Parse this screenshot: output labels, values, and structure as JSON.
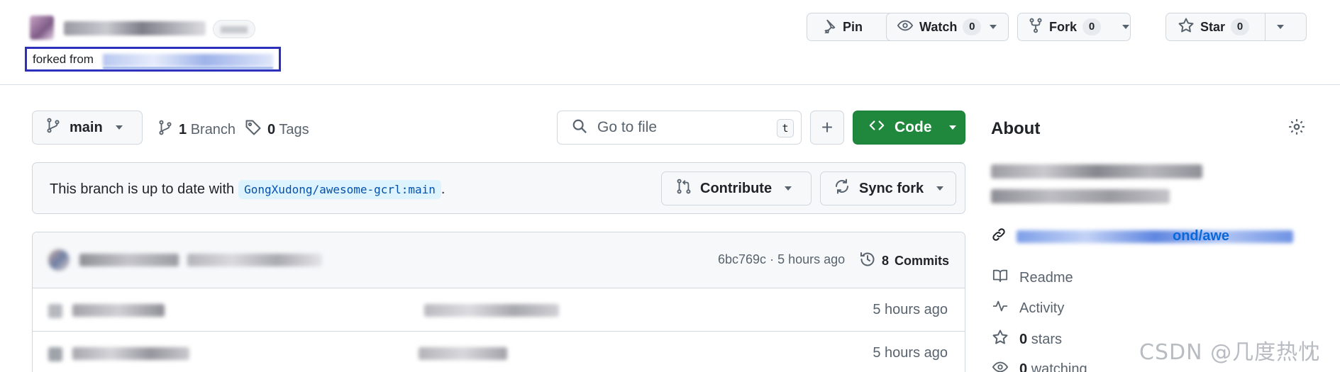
{
  "header": {
    "forked_from_label": "forked from",
    "pin_label": "Pin",
    "watch_label": "Watch",
    "watch_count": "0",
    "fork_label": "Fork",
    "fork_count": "0",
    "star_label": "Star",
    "star_count": "0"
  },
  "branch_bar": {
    "current_branch": "main",
    "branch_count": "1",
    "branch_label": "Branch",
    "tag_count": "0",
    "tag_label": "Tags",
    "search_placeholder": "Go to file",
    "search_shortcut": "t",
    "add_label": "+",
    "code_label": "Code"
  },
  "sync": {
    "status_text": "This branch is up to date with",
    "upstream_ref": "GongXudong/awesome-gcrl:main",
    "trailing": ".",
    "contribute_label": "Contribute",
    "sync_fork_label": "Sync fork"
  },
  "latest_commit": {
    "hash": "6bc769c",
    "separator": "·",
    "time": "5 hours ago",
    "commits_count": "8",
    "commits_label": "Commits"
  },
  "files": [
    {
      "time": "5 hours ago"
    },
    {
      "time": "5 hours ago"
    }
  ],
  "about": {
    "title": "About",
    "link_partial": "ond/awe",
    "readme_label": "Readme",
    "activity_label": "Activity",
    "stars_count": "0",
    "stars_label": "stars",
    "watching_count": "0",
    "watching_label": "watching"
  },
  "watermark": "CSDN @几度热忱",
  "colors": {
    "accent_green": "#1f883d",
    "link_blue": "#0969da",
    "highlight_box": "#2d2fbd"
  }
}
